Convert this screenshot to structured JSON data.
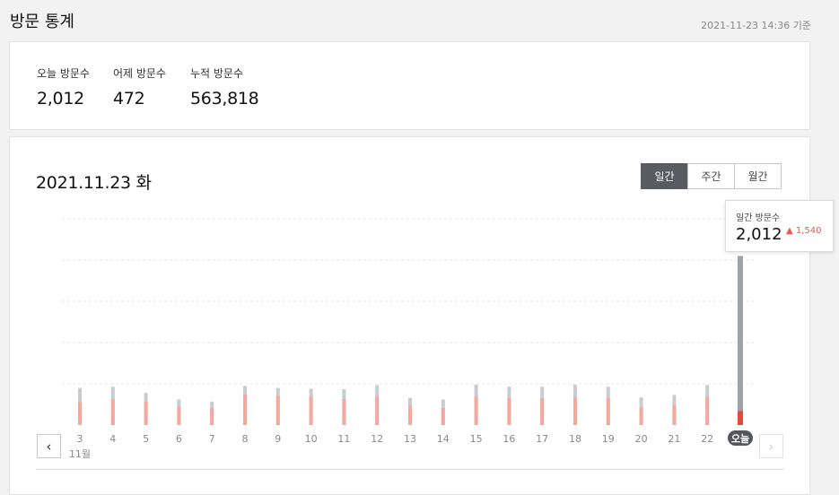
{
  "page": {
    "title": "방문 통계",
    "updated": "2021-11-23 14:36 기준"
  },
  "summary": {
    "today": {
      "label": "오늘 방문수",
      "value": "2,012"
    },
    "yesterday": {
      "label": "어제 방문수",
      "value": "472"
    },
    "total": {
      "label": "누적 방문수",
      "value": "563,818"
    }
  },
  "chart": {
    "date_title": "2021.11.23 화",
    "period_tabs": [
      {
        "label": "일간",
        "active": true
      },
      {
        "label": "주간",
        "active": false
      },
      {
        "label": "월간",
        "active": false
      }
    ],
    "tooltip": {
      "label": "일간 방문수",
      "value": "2,012",
      "delta": "▲ 1,540"
    },
    "month_label": "11월",
    "prev_icon": "‹",
    "next_icon": "›"
  },
  "colors": {
    "visits": "#f5a89e",
    "visits_today": "#e8473b",
    "pageviews": "#c8ccd1",
    "pageviews_today": "#9ea3aa",
    "today_badge": "#53575c",
    "delta_up": "#e85a4f"
  },
  "chart_data": {
    "type": "bar",
    "categories": [
      "3",
      "4",
      "5",
      "6",
      "7",
      "8",
      "9",
      "10",
      "11",
      "12",
      "13",
      "14",
      "15",
      "16",
      "17",
      "18",
      "19",
      "20",
      "21",
      "22",
      "오늘"
    ],
    "series": [
      {
        "values": [
          550,
          630,
          570,
          440,
          420,
          740,
          700,
          690,
          630,
          690,
          470,
          410,
          700,
          650,
          650,
          670,
          650,
          430,
          490,
          680,
          340
        ]
      },
      {
        "values": [
          900,
          930,
          780,
          620,
          570,
          950,
          900,
          880,
          870,
          970,
          660,
          620,
          980,
          930,
          930,
          980,
          930,
          670,
          730,
          970,
          4100
        ]
      }
    ],
    "ylim": [
      0,
      5000
    ]
  }
}
